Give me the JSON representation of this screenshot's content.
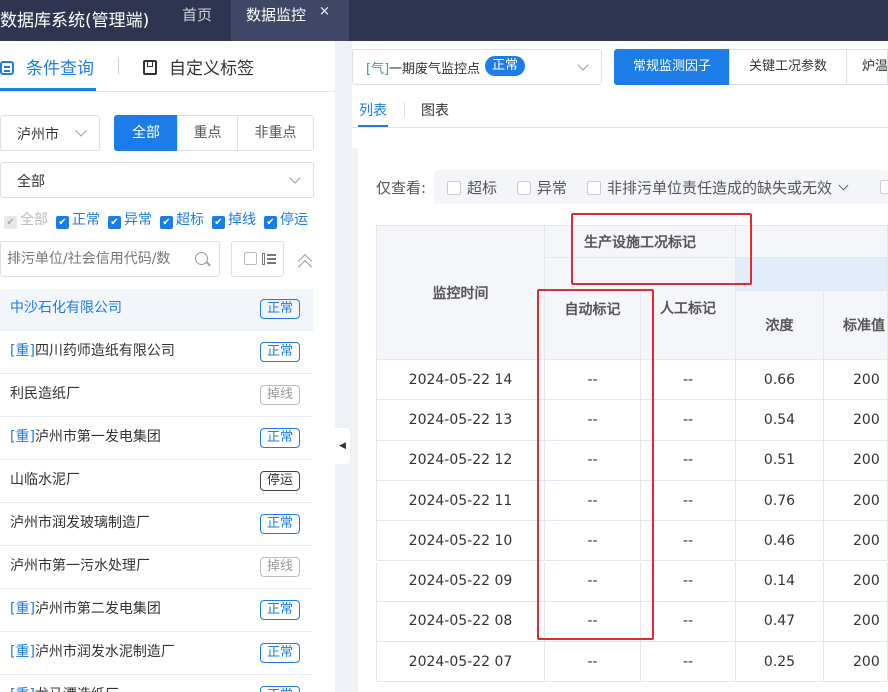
{
  "app": {
    "title": "数据库系统(管理端)",
    "tabs": [
      {
        "label": "首页"
      },
      {
        "label": "数据监控"
      }
    ],
    "close_glyph": "×"
  },
  "sidebar": {
    "tabs": {
      "query": "条件查询",
      "custom_tags": "自定义标签"
    },
    "city": "泸州市",
    "segments": [
      "全部",
      "重点",
      "非重点"
    ],
    "category": "全部",
    "checkboxes": [
      {
        "label": "全部",
        "checked": true,
        "disabled": true
      },
      {
        "label": "正常",
        "checked": true
      },
      {
        "label": "异常",
        "checked": true
      },
      {
        "label": "超标",
        "checked": true
      },
      {
        "label": "掉线",
        "checked": true
      },
      {
        "label": "停运",
        "checked": true
      }
    ],
    "search_placeholder": "排污单位/社会信用代码/数",
    "orgs": [
      {
        "mark": "",
        "name": "中沙石化有限公司",
        "status": "正常",
        "kind": "normal",
        "selected": true
      },
      {
        "mark": "[重]",
        "name": "四川药师造纸有限公司",
        "status": "正常",
        "kind": "normal"
      },
      {
        "mark": "",
        "name": "利民造纸厂",
        "status": "掉线",
        "kind": "off"
      },
      {
        "mark": "[重]",
        "name": "泸州市第一发电集团",
        "status": "正常",
        "kind": "normal"
      },
      {
        "mark": "",
        "name": "山临水泥厂",
        "status": "停运",
        "kind": "stop"
      },
      {
        "mark": "",
        "name": "泸州市润发玻璃制造厂",
        "status": "正常",
        "kind": "normal"
      },
      {
        "mark": "",
        "name": "泸州市第一污水处理厂",
        "status": "掉线",
        "kind": "off"
      },
      {
        "mark": "[重]",
        "name": "泸州市第二发电集团",
        "status": "正常",
        "kind": "normal"
      },
      {
        "mark": "[重]",
        "name": "泸州市润发水泥制造厂",
        "status": "正常",
        "kind": "normal"
      },
      {
        "mark": "[重]",
        "name": "龙马潭造纸厂",
        "status": "正常",
        "kind": "normal"
      }
    ]
  },
  "main": {
    "point": {
      "prefix": "[气]",
      "name": "一期废气监控点",
      "status": "正常"
    },
    "param_tabs": [
      "常规监测因子",
      "关键工况参数",
      "炉温"
    ],
    "view_tabs": [
      "列表",
      "图表"
    ],
    "filter": {
      "label": "仅查看:",
      "options": [
        "超标",
        "异常",
        "非排污单位责任造成的缺失或无效"
      ]
    },
    "table": {
      "headers": {
        "time": "监控时间",
        "group": "生产设施工况标记",
        "auto": "自动标记",
        "manual": "人工标记",
        "conc": "浓度",
        "std": "标准值"
      },
      "rows": [
        {
          "time": "2024-05-22 14",
          "auto": "--",
          "manual": "--",
          "conc": "0.66",
          "std": "200"
        },
        {
          "time": "2024-05-22 13",
          "auto": "--",
          "manual": "--",
          "conc": "0.54",
          "std": "200"
        },
        {
          "time": "2024-05-22 12",
          "auto": "--",
          "manual": "--",
          "conc": "0.51",
          "std": "200"
        },
        {
          "time": "2024-05-22 11",
          "auto": "--",
          "manual": "--",
          "conc": "0.76",
          "std": "200"
        },
        {
          "time": "2024-05-22 10",
          "auto": "--",
          "manual": "--",
          "conc": "0.46",
          "std": "200"
        },
        {
          "time": "2024-05-22 09",
          "auto": "--",
          "manual": "--",
          "conc": "0.14",
          "std": "200"
        },
        {
          "time": "2024-05-22 08",
          "auto": "--",
          "manual": "--",
          "conc": "0.47",
          "std": "200"
        },
        {
          "time": "2024-05-22 07",
          "auto": "--",
          "manual": "--",
          "conc": "0.25",
          "std": "200"
        }
      ]
    }
  },
  "colors": {
    "accent": "#1c7ce8",
    "topbar": "#2f3550",
    "highlight_box": "#e6292e"
  },
  "icons": [
    "grid-icon",
    "bookmark-icon",
    "chevron-down-icon",
    "search-icon",
    "list-settings-icon",
    "chevron-up-icon",
    "chevron-left-icon",
    "close-icon"
  ]
}
